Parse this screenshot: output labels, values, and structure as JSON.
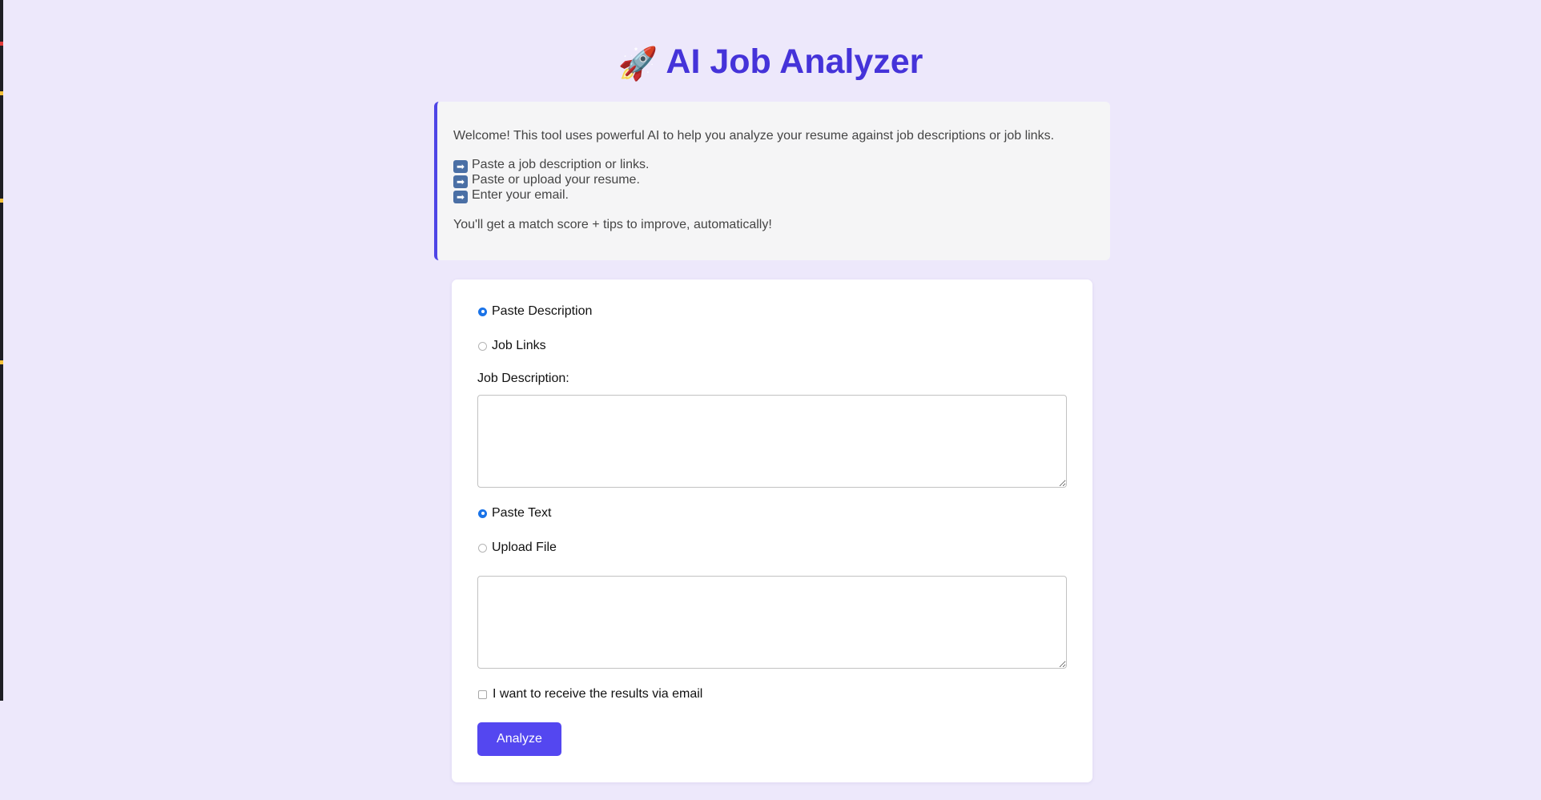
{
  "header": {
    "icon": "rocket-icon",
    "icon_glyph": "🚀",
    "title": "AI Job Analyzer"
  },
  "intro": {
    "welcome": "Welcome! This tool uses powerful AI to help you analyze your resume against job descriptions or job links.",
    "steps": [
      "Paste a job description or links.",
      "Paste or upload your resume.",
      "Enter your email."
    ],
    "step_icon": "arrow-right-icon",
    "outro": "You'll get a match score + tips to improve, automatically!"
  },
  "form": {
    "job_source": {
      "options": [
        "Paste Description",
        "Job Links"
      ],
      "selected": "Paste Description"
    },
    "job_description_label": "Job Description:",
    "job_description_value": "",
    "resume_source": {
      "options": [
        "Paste Text",
        "Upload File"
      ],
      "selected": "Paste Text"
    },
    "resume_value": "",
    "email_opt_in_label": "I want to receive the results via email",
    "email_opt_in_checked": false,
    "submit_label": "Analyze"
  },
  "colors": {
    "background": "#ede8fb",
    "title": "#4533d9",
    "accent": "#5447f0",
    "radio_selected": "#1a73e8"
  }
}
